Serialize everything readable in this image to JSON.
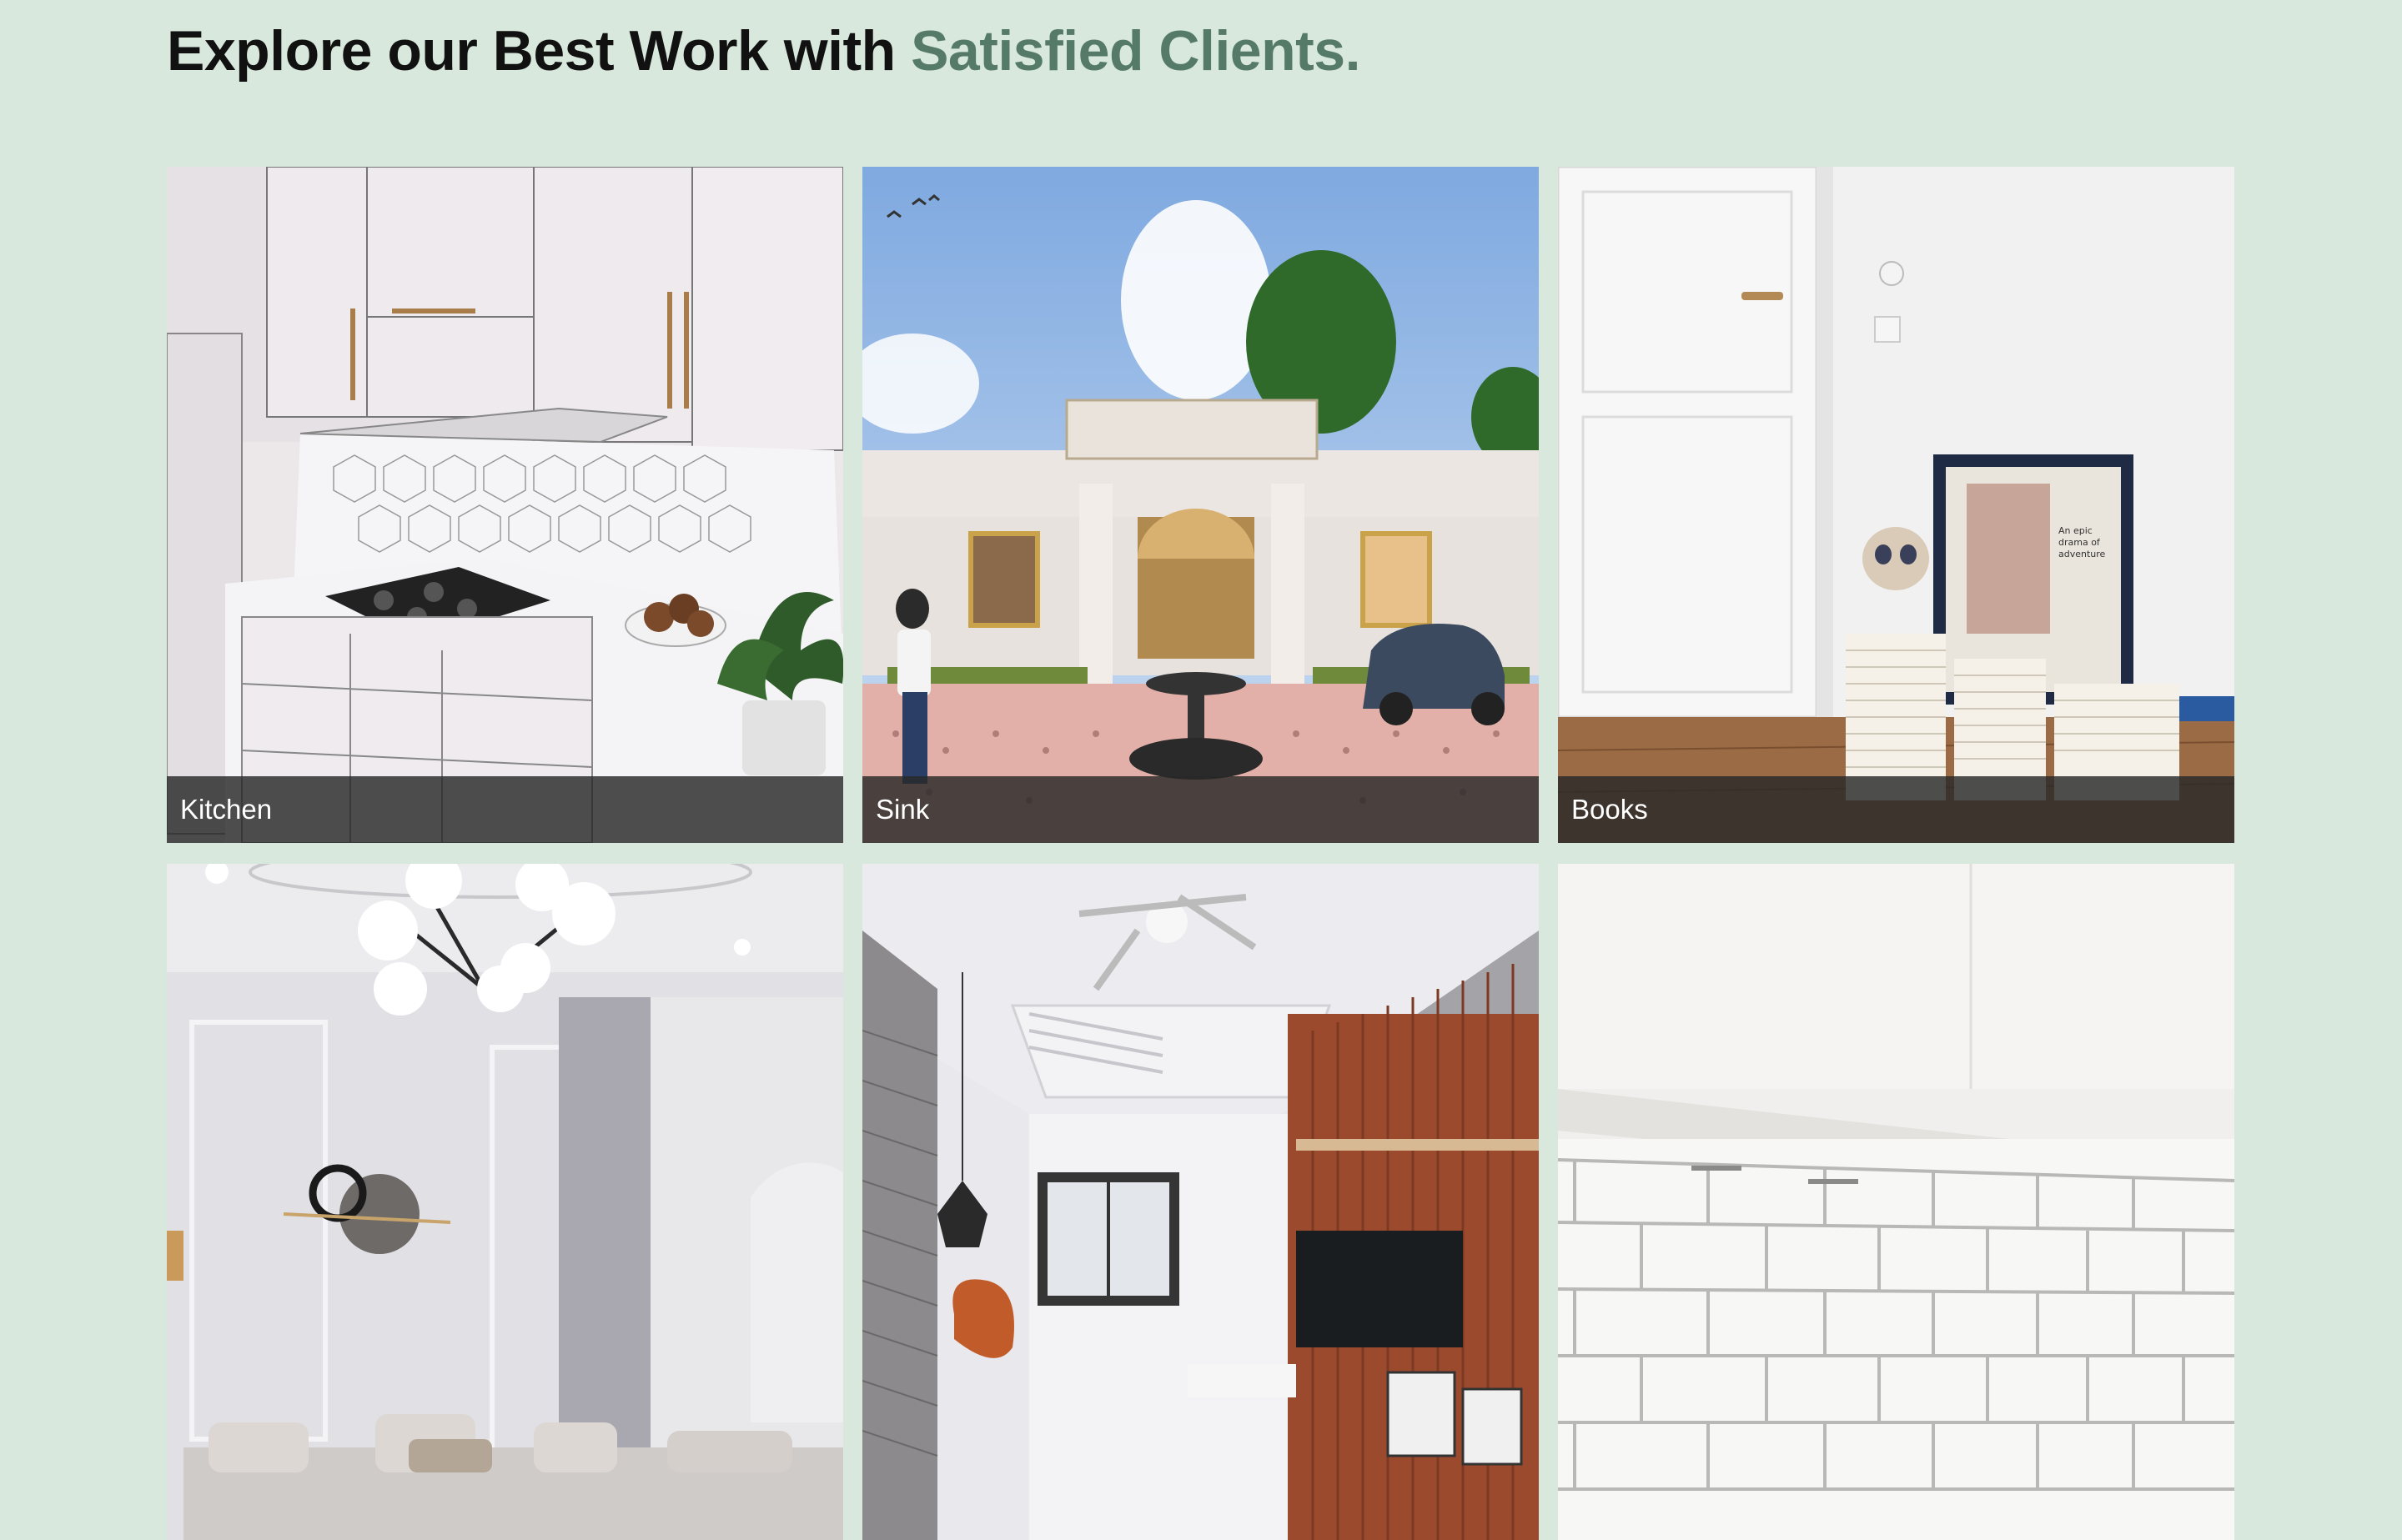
{
  "heading": {
    "lead": "Explore our Best Work with ",
    "accent": "Satisfied Clients."
  },
  "gallery": [
    {
      "label": "Kitchen",
      "image": "kitchen-render-image"
    },
    {
      "label": "Sink",
      "image": "villa-exterior-image"
    },
    {
      "label": "Books",
      "image": "books-by-door-image"
    },
    {
      "label": "",
      "image": "living-room-chandelier-image"
    },
    {
      "label": "",
      "image": "bedroom-brick-wall-image"
    },
    {
      "label": "",
      "image": "white-tile-backsplash-image"
    }
  ],
  "colors": {
    "page_background": "#d8e8dd",
    "accent": "#557a68",
    "caption_bar": "#282828"
  }
}
